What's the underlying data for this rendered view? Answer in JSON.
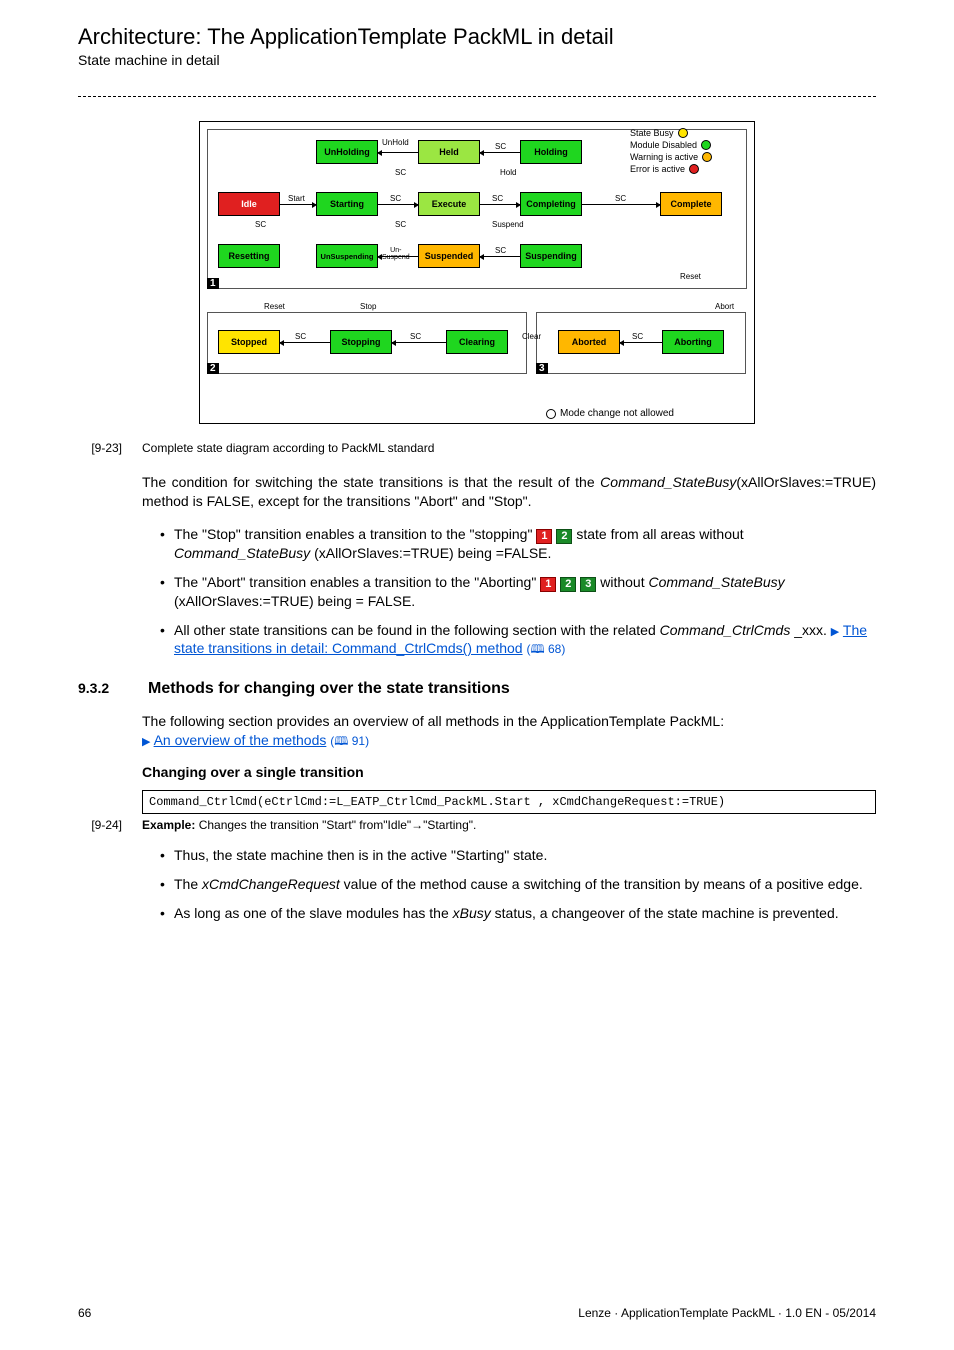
{
  "header": {
    "title": "Architecture: The ApplicationTemplate PackML in detail",
    "subtitle": "State machine in detail"
  },
  "diagram": {
    "legend": {
      "busy": "State Busy",
      "disabled": "Module Disabled",
      "warning": "Warning is active",
      "error": "Error is active"
    },
    "modechange": "Mode change not allowed",
    "states": {
      "unholding": "UnHolding",
      "held": "Held",
      "holding": "Holding",
      "idle": "Idle",
      "starting": "Starting",
      "execute": "Execute",
      "completing": "Completing",
      "complete": "Complete",
      "resetting": "Resetting",
      "unsuspending": "UnSuspending",
      "suspended": "Suspended",
      "suspending": "Suspending",
      "stopped": "Stopped",
      "stopping": "Stopping",
      "clearing": "Clearing",
      "aborted": "Aborted",
      "aborting": "Aborting"
    },
    "trans": {
      "unhold": "UnHold",
      "sc": "SC",
      "hold": "Hold",
      "start": "Start",
      "suspend": "Suspend",
      "unsus": "Un-\nSuspend",
      "reset": "Reset",
      "stop": "Stop",
      "clear": "Clear",
      "abort": "Abort"
    }
  },
  "caption923": {
    "key": "[9-23]",
    "text": "Complete state diagram according to PackML standard"
  },
  "para1_a": "The condition for switching the state transitions is that the result of the ",
  "para1_b": "Command_StateBusy",
  "para1_c": "(xAllOrSlaves:=TRUE) method is FALSE, except for the transitions \"Abort\" and \"Stop\".",
  "b1_a": "The \"Stop\" transition enables a transition to the \"stopping\" ",
  "b1_b": " state from all areas without ",
  "b1_c": "Command_StateBusy",
  "b1_d": " (xAllOrSlaves:=TRUE) being =FALSE.",
  "b2_a": "The \"Abort\" transition enables a transition to the \"Aborting\" ",
  "b2_b": " without ",
  "b2_c": "Command_StateBusy",
  "b2_d": " (xAllOrSlaves:=TRUE) being = FALSE.",
  "b3_a": "All other state transitions can be found in the following section with the related ",
  "b3_b": "Command_CtrlCmds",
  "b3_c": " _xxx. ",
  "b3_link": "The state transitions in detail: Command_CtrlCmds() method",
  "b3_page": "68",
  "section932": {
    "num": "9.3.2",
    "title": "Methods for changing over the state transitions"
  },
  "para2_a": "The following section provides an overview of all methods in the ApplicationTemplate PackML: ",
  "para2_link": "An overview of the methods",
  "para2_page": "91",
  "subhead": "Changing over a single transition",
  "code": "Command_CtrlCmd(eCtrlCmd:=L_EATP_CtrlCmd_PackML.Start , xCmdChangeRequest:=TRUE)",
  "caption924": {
    "key": "[9-24]",
    "bold": "Example:",
    "text": " Changes the transition \"Start\" from\"Idle\"→\"Starting\"."
  },
  "bl2_1": "Thus, the state machine then is in the active \"Starting\" state.",
  "bl2_2a": "The ",
  "bl2_2b": "xCmdChangeRequest",
  "bl2_2c": " value of the method cause a switching of the transition by means of a positive edge.",
  "bl2_3a": "As long as one of the slave modules has the ",
  "bl2_3b": "xBusy",
  "bl2_3c": " status, a changeover of the state machine is prevented.",
  "footer": {
    "page": "66",
    "ref": "Lenze · ApplicationTemplate PackML · 1.0 EN - 05/2014"
  }
}
